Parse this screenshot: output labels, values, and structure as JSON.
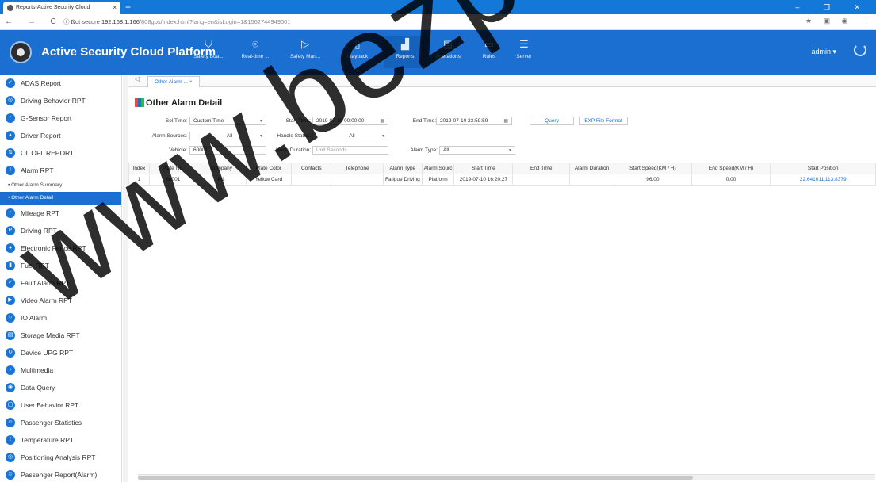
{
  "browser": {
    "tab_title": "Reports-Active Security Cloud",
    "tab_close": "×",
    "new_tab": "+",
    "nav_controls": "← → C ⌂",
    "not_secure": "ⓘ Not secure",
    "url_host": "192.168.1.166",
    "url_path": "/808gps/index.html?lang=en&isLogin=1&1562744949001",
    "window_controls": "– ❐ ✕"
  },
  "header": {
    "brand": "Active Security Cloud Platform",
    "nav": [
      {
        "label": "Safety Boa...",
        "icon": "shield-icon"
      },
      {
        "label": "Real-time ...",
        "icon": "location-icon"
      },
      {
        "label": "Safety Man...",
        "icon": "play-circle-icon"
      },
      {
        "label": "Playback",
        "icon": "playback-icon"
      },
      {
        "label": "Reports",
        "icon": "bar-chart-icon"
      },
      {
        "label": "Operations",
        "icon": "operations-icon"
      },
      {
        "label": "Rules",
        "icon": "rules-icon"
      },
      {
        "label": "Server",
        "icon": "server-icon"
      }
    ],
    "user": "admin ▾"
  },
  "sidebar": {
    "items": [
      {
        "label": "ADAS Report"
      },
      {
        "label": "Driving Behavior RPT"
      },
      {
        "label": "G-Sensor Report"
      },
      {
        "label": "Driver Report"
      },
      {
        "label": "OL OFL REPORT"
      },
      {
        "label": "Alarm RPT"
      },
      {
        "label": "Mileage RPT"
      },
      {
        "label": "Driving RPT"
      },
      {
        "label": "Electronic Fence RPT"
      },
      {
        "label": "Fuel RPT"
      },
      {
        "label": "Fault Alarm RPT"
      },
      {
        "label": "Video Alarm RPT"
      },
      {
        "label": "IO Alarm"
      },
      {
        "label": "Storage Media RPT"
      },
      {
        "label": "Device UPG RPT"
      },
      {
        "label": "Multimedia"
      },
      {
        "label": "Data Query"
      },
      {
        "label": "User Behavior RPT"
      },
      {
        "label": "Passenger Statistics"
      },
      {
        "label": "Temperature RPT"
      },
      {
        "label": "Positioning Analysis RPT"
      },
      {
        "label": "Passenger Report(Alarm)"
      }
    ],
    "subitems": [
      "• Other Alarm Summary",
      "• Other Alarm Detail"
    ]
  },
  "content": {
    "tab_label": "Other Alarm ... ×",
    "page_title": "Other Alarm Detail",
    "filters": {
      "sel_time_label": "Sel Time:",
      "sel_time_value": "Custom Time",
      "start_time_label": "Start Time:",
      "start_time_value": "2019-07-10 00:00:00",
      "end_time_label": "End Time:",
      "end_time_value": "2019-07-10 23:59:59",
      "query_button": "Query",
      "export_button": "EXP File Format",
      "alarm_sources_label": "Alarm Sources:",
      "alarm_sources_value": "All",
      "handle_status_label": "Handle Status:",
      "handle_status_value": "All",
      "vehicle_label": "Vehicle:",
      "vehicle_value": "60001",
      "alarm_duration_label": "Alarm Duration:",
      "alarm_duration_placeholder": "Unit Seconds",
      "alarm_type_label": "Alarm Type:",
      "alarm_type_value": "All"
    },
    "table": {
      "columns": [
        "Index",
        "Plate No.",
        "Company",
        "Plate Color",
        "Contacts",
        "Telephone",
        "Alarm Type",
        "Alarm Sourc",
        "Start Time",
        "End Time",
        "Alarm Duration",
        "Start Speed(KM / H)",
        "End Speed(KM / H)",
        "Start Position"
      ],
      "rows": [
        [
          "1",
          "60001",
          "M1",
          "Yellow Card",
          "",
          "",
          "Fatigue Driving",
          "Platform",
          "2019-07-10 16:20:27",
          "",
          "",
          "96.00",
          "0.00",
          "22.641011,113.8379"
        ]
      ]
    }
  },
  "watermark": "www.bezpeka"
}
